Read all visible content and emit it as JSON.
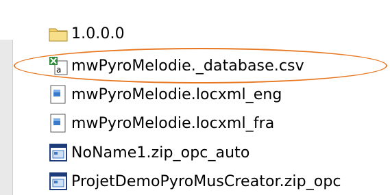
{
  "files": [
    {
      "name": "1.0.0.0",
      "icon": "folder-icon"
    },
    {
      "name": "mwPyroMelodie._database.csv",
      "icon": "excel-csv-icon"
    },
    {
      "name": "mwPyroMelodie.locxml_eng",
      "icon": "document-icon"
    },
    {
      "name": "mwPyroMelodie.locxml_fra",
      "icon": "document-icon"
    },
    {
      "name": "NoName1.zip_opc_auto",
      "icon": "application-icon"
    },
    {
      "name": "ProjetDemoPyroMusCreator.zip_opc",
      "icon": "application-icon"
    }
  ],
  "colors": {
    "annotation": "#e87722",
    "folder": "#f3d46a",
    "excel_green": "#2e8b3a",
    "doc_blue": "#3b79c9"
  }
}
